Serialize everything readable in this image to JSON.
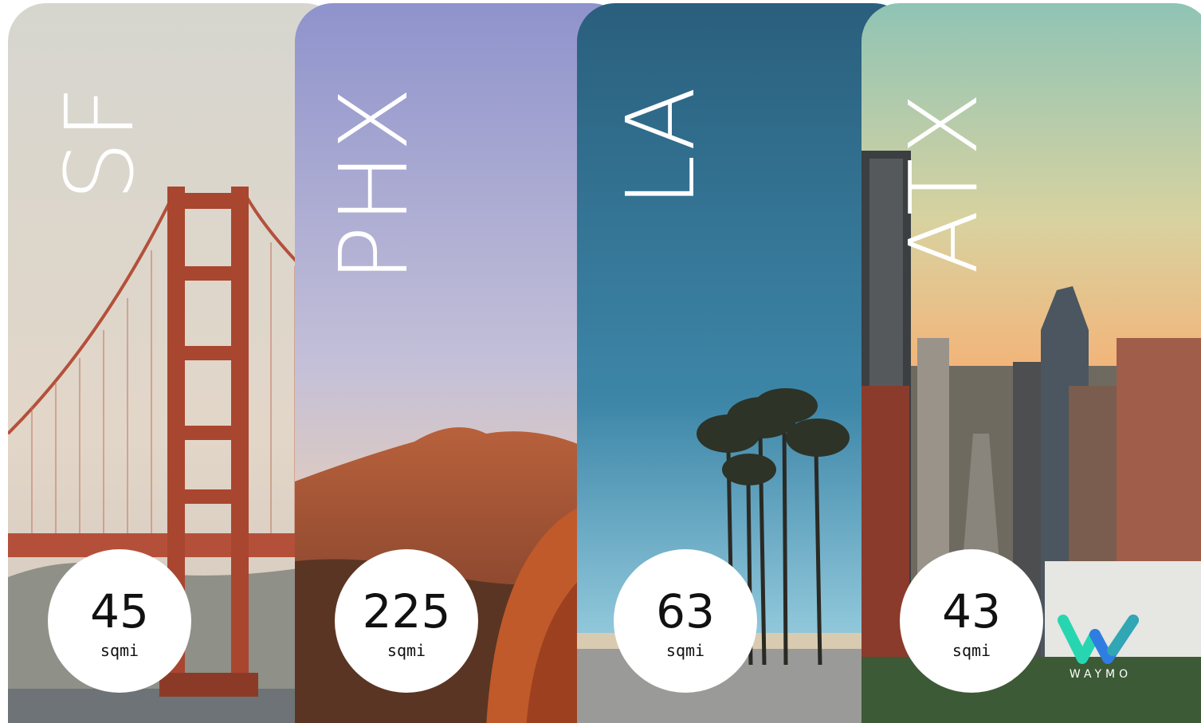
{
  "cities": [
    {
      "code": "SF",
      "value": "45",
      "unit": "sqmi"
    },
    {
      "code": "PHX",
      "value": "225",
      "unit": "sqmi"
    },
    {
      "code": "LA",
      "value": "63",
      "unit": "sqmi"
    },
    {
      "code": "ATX",
      "value": "43",
      "unit": "sqmi"
    }
  ],
  "logo": {
    "word": "WAYMO",
    "icon": "waymo-logo-icon"
  },
  "colors": {
    "sf_sky": "#d9d6cf",
    "bridge": "#b8503a",
    "phx_sky": "#9a9dd0",
    "phx_rock": "#c2582a",
    "la_sky": "#2f6f8f",
    "atx_sky": "#f0b97a",
    "logo_teal": "#27d6b0",
    "logo_blue": "#2f7de0"
  }
}
